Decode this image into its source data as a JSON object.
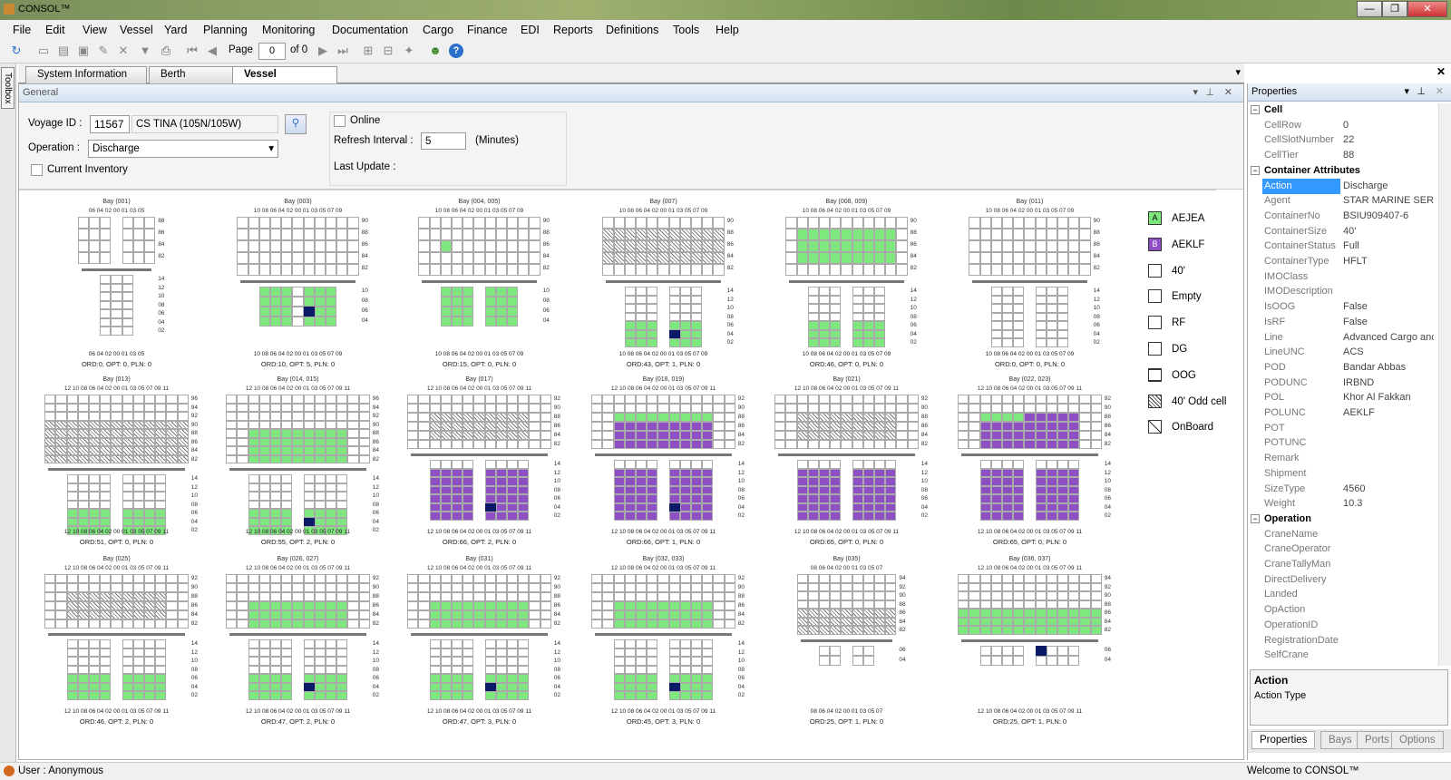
{
  "window": {
    "title": "CONSOL™",
    "min": "—",
    "max": "❐",
    "close": "✕"
  },
  "menu": [
    "File",
    "Edit",
    "View",
    "Vessel",
    "Yard",
    "Planning",
    "Monitoring",
    "Documentation",
    "Cargo",
    "Finance",
    "EDI",
    "Reports",
    "Definitions",
    "Tools",
    "Help"
  ],
  "toolbar": {
    "page_label": "Page",
    "page_value": "0",
    "of_label": "of 0"
  },
  "toolbox_label": "Toolbox",
  "tabs": [
    "System Information",
    "Berth Planning",
    "Vessel Monitoring"
  ],
  "active_tab": "Vessel Monitoring",
  "general": {
    "header": "General",
    "voyage_label": "Voyage ID :",
    "voyage_id": "11567",
    "vessel_name": "CS TINA (105N/105W)",
    "operation_label": "Operation :",
    "operation_value": "Discharge",
    "current_inventory_label": "Current Inventory",
    "online_label": "Online",
    "refresh_label": "Refresh Interval :",
    "refresh_value": "5",
    "minutes_label": "(Minutes)",
    "last_update_label": "Last Update :"
  },
  "colors": {
    "aejea": "#7ee77e",
    "aeklf": "#8e4fc4",
    "onboard": "#0b1a66",
    "cell_border": "#aaaaaa",
    "hatch": "#777777"
  },
  "bays": [
    {
      "title": "Bay (001)",
      "footer": "ORD:0, OPT: 0, PLN: 0",
      "deck_cols": "06 04 02 00 01 03 05",
      "hold_cols": "06 04 02 00 01 03 05",
      "deck_tiers": [
        "88",
        "86",
        "84",
        "82"
      ],
      "hold_tiers": [
        "14",
        "12",
        "10",
        "08",
        "06",
        "04",
        "02"
      ]
    },
    {
      "title": "Bay (003)",
      "footer": "ORD:10, OPT: 5, PLN: 0",
      "deck_cols": "10 08 06 04 02 00 01 03 05 07 09",
      "hold_cols": "10 08 06 04 02 00 01 03 05 07 09",
      "deck_tiers": [
        "90",
        "88",
        "86",
        "84",
        "82"
      ],
      "hold_tiers": [
        "10",
        "08",
        "06",
        "04"
      ]
    },
    {
      "title": "Bay (004, 005)",
      "footer": "ORD:15, OPT: 0, PLN: 0",
      "deck_cols": "10 08 06 04 02 00 01 03 05 07 09",
      "hold_cols": "10 08 06 04 02 00 01 03 05 07 09",
      "deck_tiers": [
        "90",
        "88",
        "86",
        "84",
        "82"
      ],
      "hold_tiers": [
        "10",
        "08",
        "06",
        "04"
      ]
    },
    {
      "title": "Bay (007)",
      "footer": "ORD:43, OPT: 1, PLN: 0",
      "deck_cols": "10 08 06 04 02 00 01 03 05 07 09",
      "hold_cols": "10 08 06 04 02 00 01 03 05 07 09",
      "deck_tiers": [
        "90",
        "88",
        "86",
        "84",
        "82"
      ],
      "hold_tiers": [
        "14",
        "12",
        "10",
        "08",
        "06",
        "04",
        "02"
      ]
    },
    {
      "title": "Bay (008, 009)",
      "footer": "ORD:46, OPT: 0, PLN: 0",
      "deck_cols": "10 08 06 04 02 00 01 03 05 07 09",
      "hold_cols": "10 08 06 04 02 00 01 03 05 07 09",
      "deck_tiers": [
        "90",
        "88",
        "86",
        "84",
        "82"
      ],
      "hold_tiers": [
        "14",
        "12",
        "10",
        "08",
        "06",
        "04",
        "02"
      ]
    },
    {
      "title": "Bay (011)",
      "footer": "ORD:0, OPT: 0, PLN: 0",
      "deck_cols": "10 08 06 04 02 00 01 03 05 07 09",
      "hold_cols": "10 08 06 04 02 00 01 03 05 07 09",
      "deck_tiers": [
        "90",
        "88",
        "86",
        "84",
        "82"
      ],
      "hold_tiers": [
        "14",
        "12",
        "10",
        "08",
        "06",
        "04",
        "02"
      ]
    },
    {
      "title": "Bay (013)",
      "footer": "ORD:51, OPT: 0, PLN: 0",
      "deck_cols": "12 10 08 06 04 02 00 01 03 05 07 09 11",
      "hold_cols": "12 10 08 06 04 02 00 01 03 05 07 09 11",
      "deck_tiers": [
        "96",
        "94",
        "92",
        "90",
        "88",
        "86",
        "84",
        "82"
      ],
      "hold_tiers": [
        "14",
        "12",
        "10",
        "08",
        "06",
        "04",
        "02"
      ]
    },
    {
      "title": "Bay (014, 015)",
      "footer": "ORD:55, OPT: 2, PLN: 0",
      "deck_cols": "12 10 08 06 04 02 00 01 03 05 07 09 11",
      "hold_cols": "12 10 08 06 04 02 00 01 03 05 07 09 11",
      "deck_tiers": [
        "96",
        "94",
        "92",
        "90",
        "88",
        "86",
        "84",
        "82"
      ],
      "hold_tiers": [
        "14",
        "12",
        "10",
        "08",
        "06",
        "04",
        "02"
      ]
    },
    {
      "title": "Bay (017)",
      "footer": "ORD:66, OPT: 2, PLN: 0",
      "deck_cols": "12 10 08 06 04 02 00 01 03 05 07 09 11",
      "hold_cols": "12 10 08 06 04 02 00 01 03 05 07 09 11",
      "deck_tiers": [
        "92",
        "90",
        "88",
        "86",
        "84",
        "82"
      ],
      "hold_tiers": [
        "14",
        "12",
        "10",
        "08",
        "06",
        "04",
        "02"
      ]
    },
    {
      "title": "Bay (018, 019)",
      "footer": "ORD:66, OPT: 1, PLN: 0",
      "deck_cols": "12 10 08 06 04 02 00 01 03 05 07 09 11",
      "hold_cols": "12 10 08 06 04 02 00 01 03 05 07 09 11",
      "deck_tiers": [
        "92",
        "90",
        "88",
        "86",
        "84",
        "82"
      ],
      "hold_tiers": [
        "14",
        "12",
        "10",
        "08",
        "06",
        "04",
        "02"
      ]
    },
    {
      "title": "Bay (021)",
      "footer": "ORD:65, OPT: 0, PLN: 0",
      "deck_cols": "12 10 08 06 04 02 00 01 03 05 07 09 11",
      "hold_cols": "12 10 08 06 04 02 00 01 03 05 07 09 11",
      "deck_tiers": [
        "92",
        "90",
        "88",
        "86",
        "84",
        "82"
      ],
      "hold_tiers": [
        "14",
        "12",
        "10",
        "08",
        "06",
        "04",
        "02"
      ]
    },
    {
      "title": "Bay (022, 023)",
      "footer": "ORD:65, OPT: 0, PLN: 0",
      "deck_cols": "12 10 08 06 04 02 00 01 03 05 07 09 11",
      "hold_cols": "12 10 08 06 04 02 00 01 03 05 07 09 11",
      "deck_tiers": [
        "92",
        "90",
        "88",
        "86",
        "84",
        "82"
      ],
      "hold_tiers": [
        "14",
        "12",
        "10",
        "08",
        "06",
        "04",
        "02"
      ]
    },
    {
      "title": "Bay (025)",
      "footer": "ORD:46, OPT: 2, PLN: 0",
      "deck_cols": "12 10 08 06 04 02 00 01 03 05 07 09 11",
      "hold_cols": "12 10 08 06 04 02 00 01 03 05 07 09 11",
      "deck_tiers": [
        "92",
        "90",
        "88",
        "86",
        "84",
        "82"
      ],
      "hold_tiers": [
        "14",
        "12",
        "10",
        "08",
        "06",
        "04",
        "02"
      ]
    },
    {
      "title": "Bay (026, 027)",
      "footer": "ORD:47, OPT: 2, PLN: 0",
      "deck_cols": "12 10 08 06 04 02 00 01 03 05 07 09 11",
      "hold_cols": "12 10 08 06 04 02 00 01 03 05 07 09 11",
      "deck_tiers": [
        "92",
        "90",
        "88",
        "86",
        "84",
        "82"
      ],
      "hold_tiers": [
        "14",
        "12",
        "10",
        "08",
        "06",
        "04",
        "02"
      ]
    },
    {
      "title": "Bay (031)",
      "footer": "ORD:47, OPT: 3, PLN: 0",
      "deck_cols": "12 10 08 06 04 02 00 01 03 05 07 09 11",
      "hold_cols": "12 10 08 06 04 02 00 01 03 05 07 09 11",
      "deck_tiers": [
        "92",
        "90",
        "88",
        "86",
        "84",
        "82"
      ],
      "hold_tiers": [
        "14",
        "12",
        "10",
        "08",
        "06",
        "04",
        "02"
      ]
    },
    {
      "title": "Bay (032, 033)",
      "footer": "ORD:45, OPT: 3, PLN: 0",
      "deck_cols": "12 10 08 06 04 02 00 01 03 05 07 09 11",
      "hold_cols": "12 10 08 06 04 02 00 01 03 05 07 09 11",
      "deck_tiers": [
        "92",
        "90",
        "88",
        "86",
        "84",
        "82"
      ],
      "hold_tiers": [
        "14",
        "12",
        "10",
        "08",
        "06",
        "04",
        "02"
      ]
    },
    {
      "title": "Bay (035)",
      "footer": "ORD:25, OPT: 1, PLN: 0",
      "deck_cols": "08 06 04 02 00 01 03 05 07",
      "hold_cols": "08 06 04 02 00 01 03 05 07",
      "deck_tiers": [
        "94",
        "92",
        "90",
        "88",
        "86",
        "84",
        "82"
      ],
      "hold_tiers": [
        "06",
        "04"
      ]
    },
    {
      "title": "Bay (036, 037)",
      "footer": "ORD:25, OPT: 1, PLN: 0",
      "deck_cols": "12 10 08 06 04 02 00 01 03 05 07 09 11",
      "hold_cols": "12 10 08 06 04 02 00 01 03 05 07 09 11",
      "deck_tiers": [
        "94",
        "92",
        "90",
        "88",
        "86",
        "84",
        "82"
      ],
      "hold_tiers": [
        "06",
        "04"
      ]
    }
  ],
  "legend": [
    {
      "label": "AEJEA",
      "mark": "A",
      "type": "aejea"
    },
    {
      "label": "AEKLF",
      "mark": "B",
      "type": "aeklf"
    },
    {
      "label": "40'",
      "mark": "",
      "type": "plain"
    },
    {
      "label": "Empty",
      "mark": "",
      "type": "plain"
    },
    {
      "label": "RF",
      "mark": "",
      "type": "plain"
    },
    {
      "label": "DG",
      "mark": "",
      "type": "plain"
    },
    {
      "label": "OOG",
      "mark": "",
      "type": "oog"
    },
    {
      "label": "40' Odd cell",
      "mark": "",
      "type": "hatch"
    },
    {
      "label": "OnBoard",
      "mark": "",
      "type": "onboard"
    }
  ],
  "properties": {
    "header": "Properties",
    "categories": [
      {
        "name": "Cell",
        "rows": [
          [
            "CellRow",
            "0"
          ],
          [
            "CellSlotNumber",
            "22"
          ],
          [
            "CellTier",
            "88"
          ]
        ]
      },
      {
        "name": "Container Attributes",
        "rows": [
          [
            "Action",
            "Discharge"
          ],
          [
            "Agent",
            "STAR MARINE SERVI"
          ],
          [
            "ContainerNo",
            "BSIU909407-6"
          ],
          [
            "ContainerSize",
            "40'"
          ],
          [
            "ContainerStatus",
            "Full"
          ],
          [
            "ContainerType",
            "HFLT"
          ],
          [
            "IMOClass",
            ""
          ],
          [
            "IMODescription",
            ""
          ],
          [
            "IsOOG",
            "False"
          ],
          [
            "IsRF",
            "False"
          ],
          [
            "Line",
            "Advanced Cargo anc"
          ],
          [
            "LineUNC",
            "ACS"
          ],
          [
            "POD",
            "Bandar Abbas"
          ],
          [
            "PODUNC",
            "IRBND"
          ],
          [
            "POL",
            "Khor Al Fakkan"
          ],
          [
            "POLUNC",
            "AEKLF"
          ],
          [
            "POT",
            ""
          ],
          [
            "POTUNC",
            ""
          ],
          [
            "Remark",
            ""
          ],
          [
            "Shipment",
            ""
          ],
          [
            "SizeType",
            "4560"
          ],
          [
            "Weight",
            "10.3"
          ]
        ]
      },
      {
        "name": "Operation",
        "rows": [
          [
            "CraneName",
            ""
          ],
          [
            "CraneOperator",
            ""
          ],
          [
            "CraneTallyMan",
            ""
          ],
          [
            "DirectDelivery",
            ""
          ],
          [
            "Landed",
            ""
          ],
          [
            "OpAction",
            ""
          ],
          [
            "OperationID",
            ""
          ],
          [
            "RegistrationDate",
            ""
          ],
          [
            "SelfCrane",
            ""
          ]
        ]
      }
    ],
    "selected": "Action",
    "desc_title": "Action",
    "desc_text": "Action Type",
    "tabs": [
      "Properties",
      "Bays",
      "Ports",
      "Options"
    ]
  },
  "status": {
    "user": "User : Anonymous",
    "welcome": "Welcome to CONSOL™"
  }
}
